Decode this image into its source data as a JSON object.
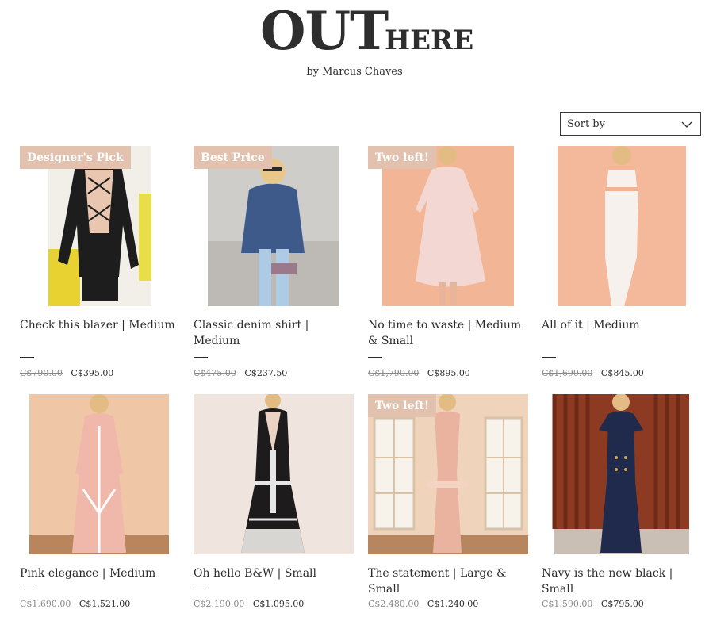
{
  "brand": {
    "main": "OUT",
    "sub": "HERE",
    "byline": "by Marcus Chaves"
  },
  "sort": {
    "label": "Sort by"
  },
  "products": [
    {
      "badge": "Designer's Pick",
      "title": "Check this blazer | Medium",
      "old_price": "C$790.00",
      "price": "C$395.00"
    },
    {
      "badge": "Best Price",
      "title": "Classic denim shirt | Medium",
      "old_price": "C$475.00",
      "price": "C$237.50"
    },
    {
      "badge": "Two left!",
      "title": "No time to waste | Medium & Small",
      "old_price": "C$1,790.00",
      "price": "C$895.00"
    },
    {
      "badge": "",
      "title": "All of it | Medium",
      "old_price": "C$1,690.00",
      "price": "C$845.00"
    },
    {
      "badge": "",
      "title": "Pink elegance | Medium",
      "old_price": "C$1,690.00",
      "price": "C$1,521.00"
    },
    {
      "badge": "",
      "title": "Oh hello B&W | Small",
      "old_price": "C$2,190.00",
      "price": "C$1,095.00"
    },
    {
      "badge": "Two left!",
      "title": "The statement | Large & Small",
      "old_price": "C$2,480.00",
      "price": "C$1,240.00"
    },
    {
      "badge": "",
      "title": "Navy is the new black | Small",
      "old_price": "C$1,590.00",
      "price": "C$795.00"
    }
  ]
}
